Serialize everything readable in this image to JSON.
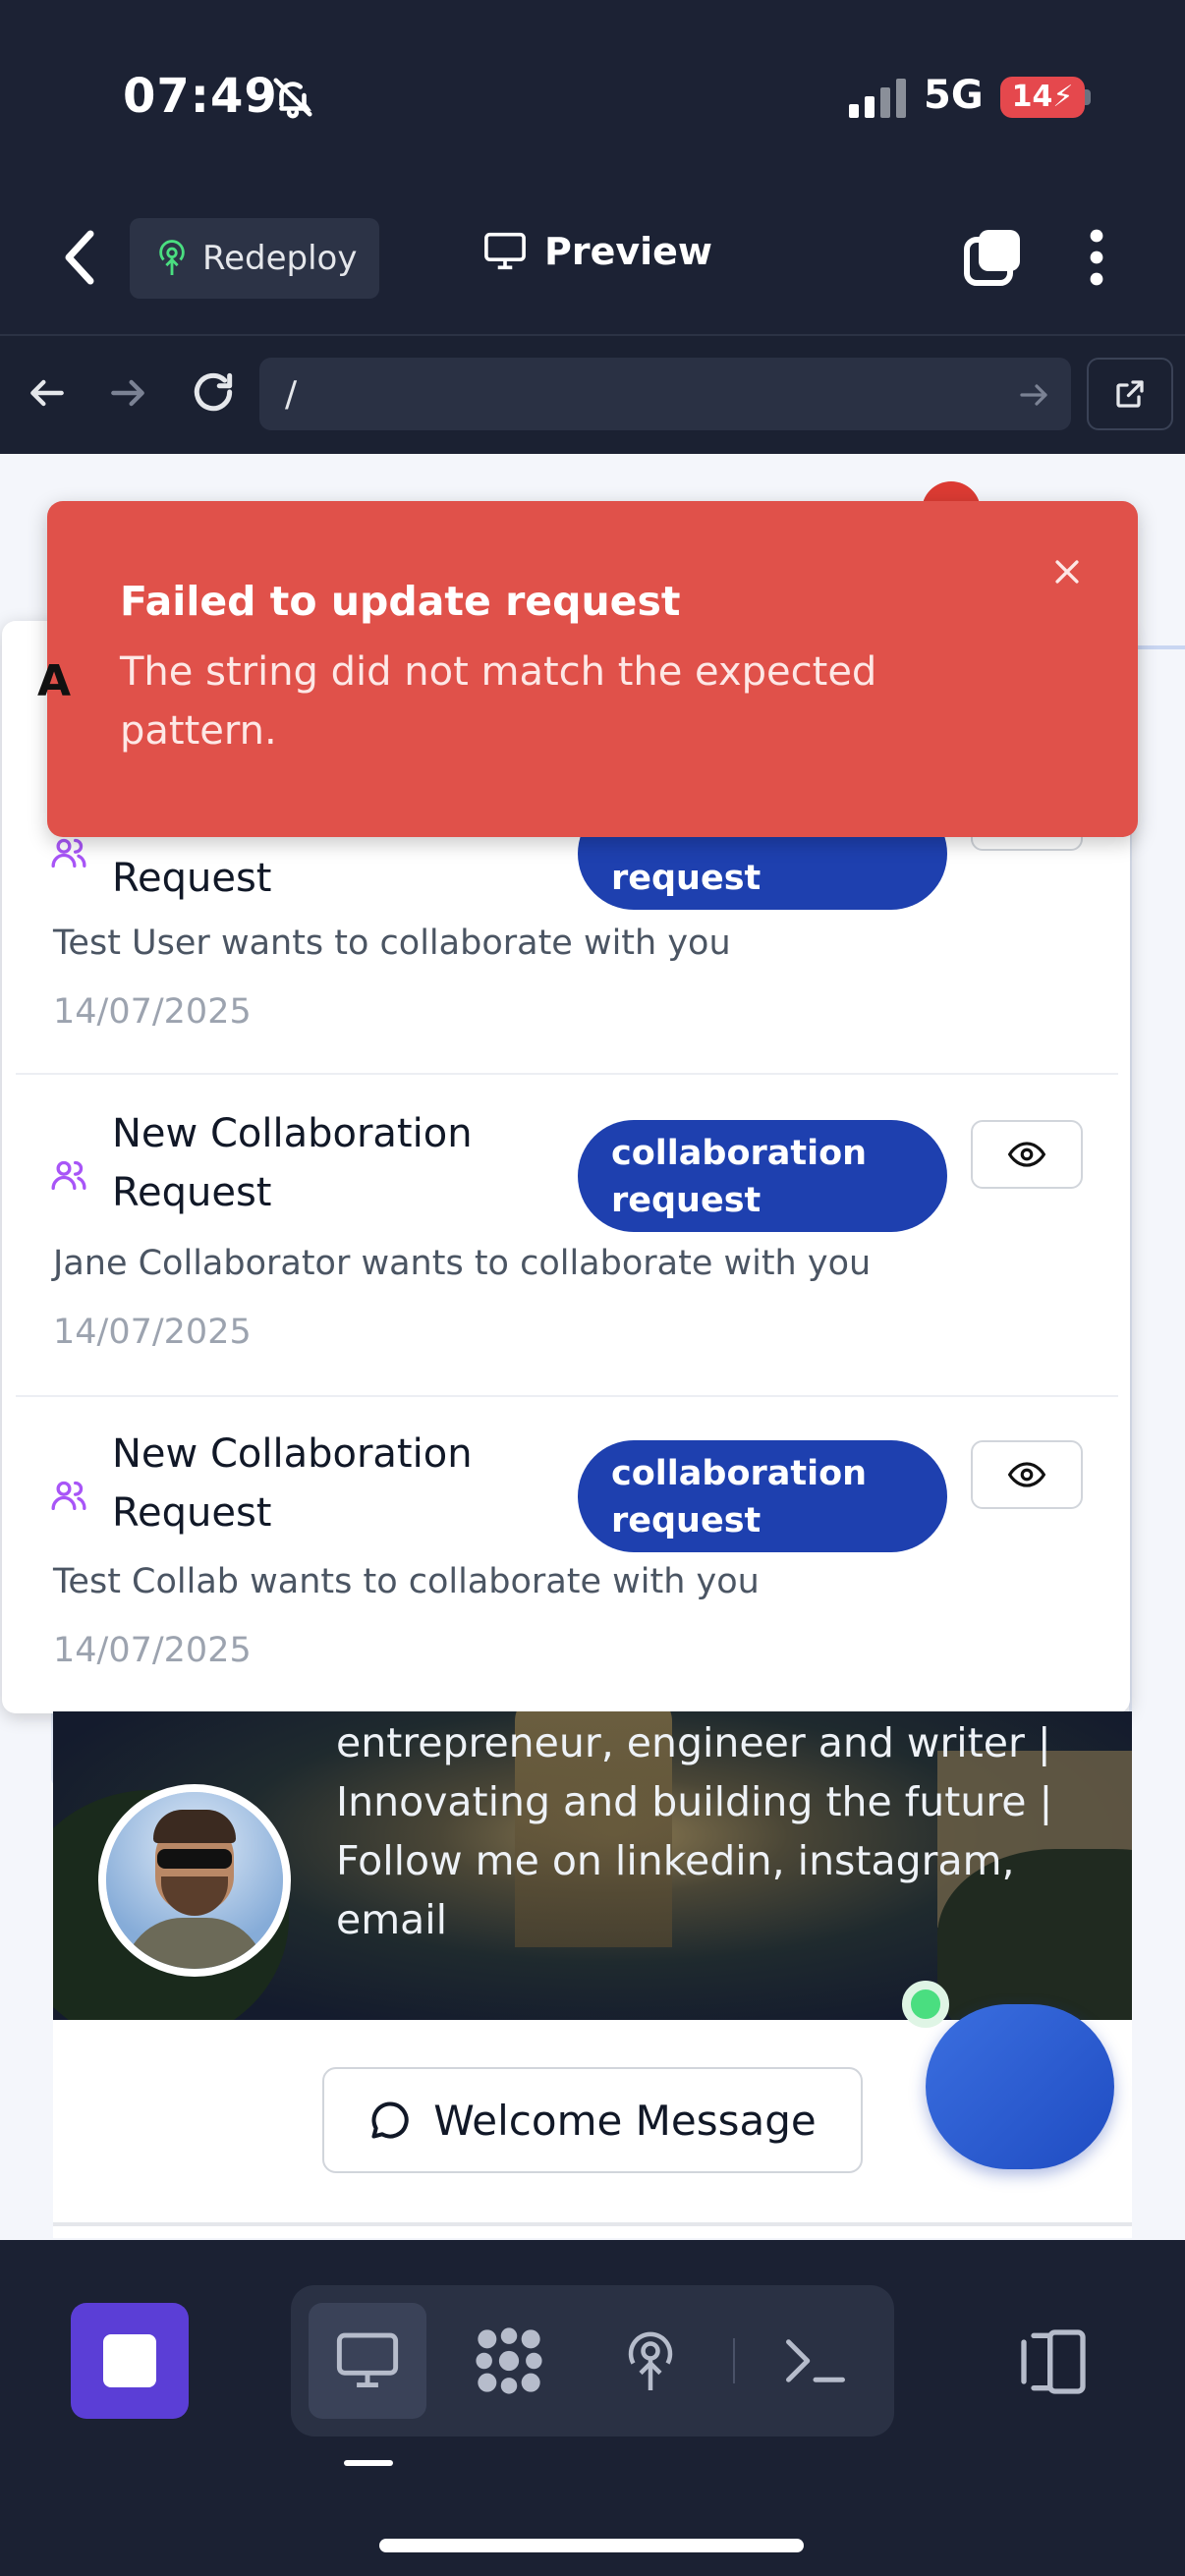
{
  "status_bar": {
    "time": "07:49",
    "network": "5G",
    "battery": "14"
  },
  "app_bar": {
    "redeploy_label": "Redeploy",
    "preview_label": "Preview"
  },
  "browser": {
    "url": "/"
  },
  "toast": {
    "title": "Failed to update request",
    "description": "The string did not match the expected pattern.",
    "color": "#e0514a"
  },
  "notifications": {
    "panel_heading_visible_letter": "A",
    "items": [
      {
        "title": "Request",
        "badge": "request",
        "message": "Test User wants to collaborate with you",
        "date": "14/07/2025"
      },
      {
        "title": "New Collaboration Request",
        "badge": "collaboration request",
        "message": "Jane Collaborator wants to collaborate with you",
        "date": "14/07/2025"
      },
      {
        "title": "New Collaboration Request",
        "badge": "collaboration request",
        "message": "Test Collab wants to collaborate with you",
        "date": "14/07/2025"
      }
    ]
  },
  "profile": {
    "bio": "entrepreneur, engineer and writer | Innovating and building the future | Follow me on linkedin, instagram, email",
    "welcome_button_label": "Welcome Message"
  },
  "colors": {
    "badge": "#1e40af",
    "stop_button": "#5b3ed6",
    "fab": "#2b5bd6"
  }
}
